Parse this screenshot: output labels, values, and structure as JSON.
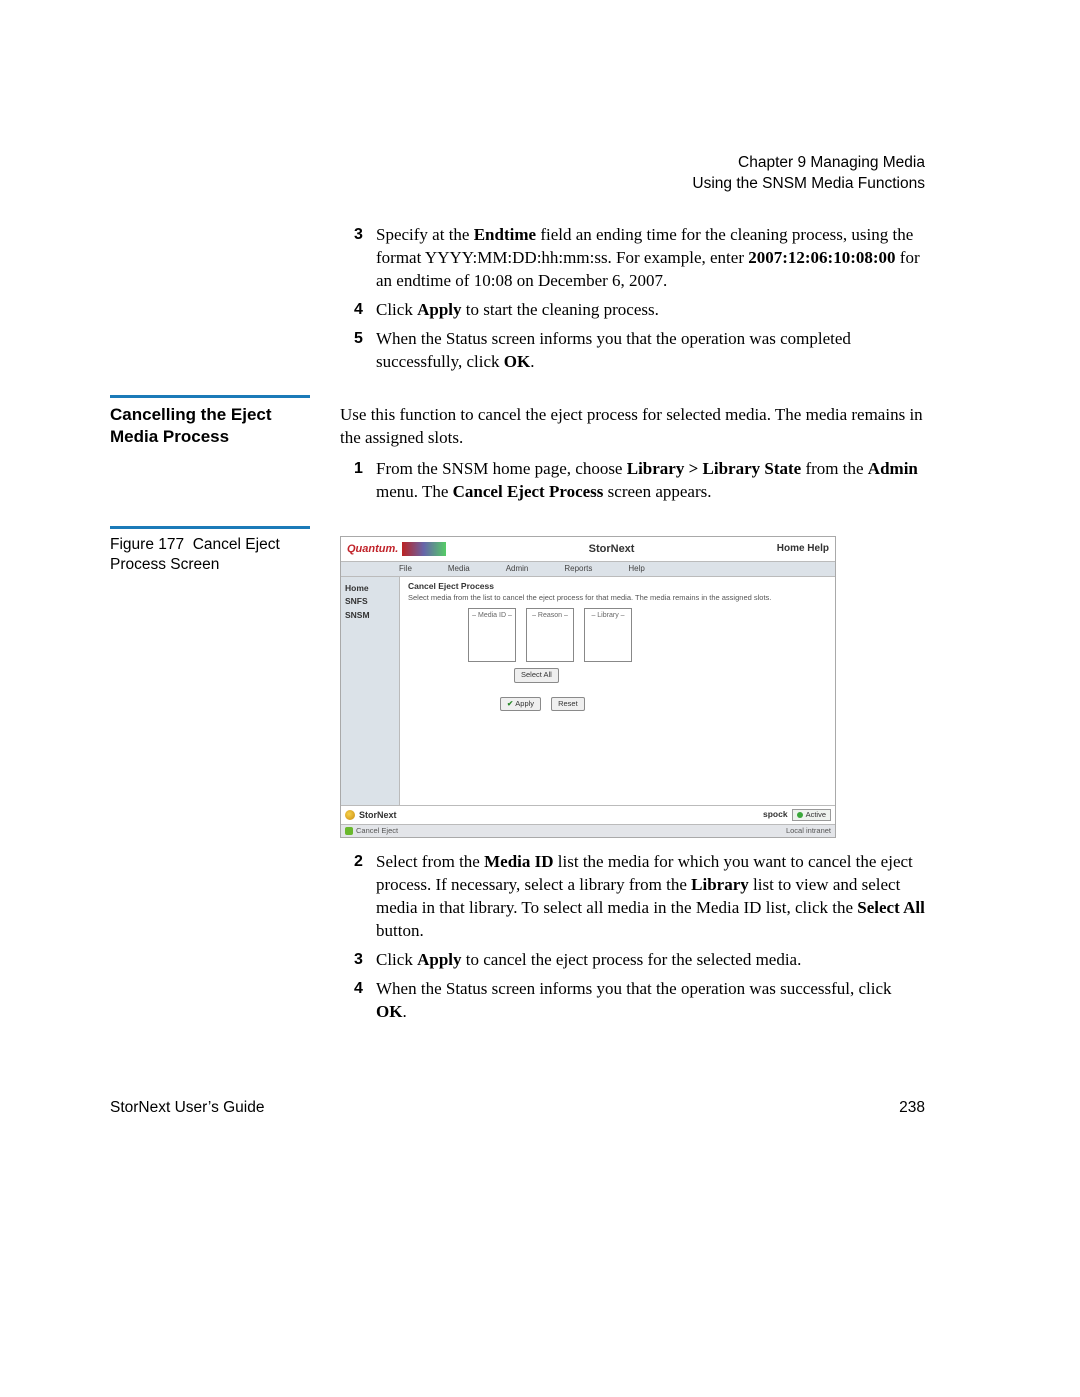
{
  "header": {
    "chapter": "Chapter 9  Managing Media",
    "subtitle": "Using the SNSM Media Functions"
  },
  "top_steps": {
    "s3": {
      "num": "3",
      "pre": "Specify at the ",
      "b1": "Endtime",
      "mid": " field an ending time for the cleaning process, using the format YYYY:MM:DD:hh:mm:ss. For example, enter ",
      "b2": "2007:12:06:10:08:00",
      "post": " for an endtime of 10:08 on December 6, 2007."
    },
    "s4": {
      "num": "4",
      "pre": "Click ",
      "b1": "Apply",
      "post": " to start the cleaning process."
    },
    "s5": {
      "num": "5",
      "pre": "When the Status screen informs you that the operation was completed successfully, click ",
      "b1": "OK",
      "post": "."
    }
  },
  "section": {
    "heading": "Cancelling the Eject Media Process",
    "intro": "Use this function to cancel the eject process for selected media. The media remains in the assigned slots.",
    "s1": {
      "num": "1",
      "pre": "From the SNSM home page, choose ",
      "b1": "Library > Library State",
      "mid": " from the ",
      "b2": "Admin",
      "mid2": " menu. The ",
      "b3": "Cancel Eject Process",
      "post": " screen appears."
    }
  },
  "figure": {
    "label": "Figure 177",
    "caption": "Cancel Eject Process Screen"
  },
  "screenshot": {
    "brand": "Quantum.",
    "app_title": "StorNext",
    "home_help": "Home  Help",
    "menus": {
      "file": "File",
      "media": "Media",
      "admin": "Admin",
      "reports": "Reports",
      "help": "Help"
    },
    "side": {
      "home": "Home",
      "snfs": "SNFS",
      "snsm": "SNSM"
    },
    "panel_title": "Cancel Eject Process",
    "panel_desc": "Select media from the list to cancel the eject process for that media. The media remains in the assigned slots.",
    "list_headers": {
      "media": "– Media ID –",
      "reason": "– Reason –",
      "library": "– Library –"
    },
    "buttons": {
      "select_all": "Select All",
      "apply": "Apply",
      "reset": "Reset"
    },
    "status_left": "StorNext",
    "status_host": "spock",
    "status_badge": "Active",
    "ie_left": "Cancel Eject",
    "ie_right": "Local intranet"
  },
  "after_steps": {
    "s2": {
      "num": "2",
      "pre": "Select from the ",
      "b1": "Media ID",
      "mid": " list the media for which you want to cancel the eject process. If necessary, select a library from the ",
      "b2": "Library",
      "mid2": " list to view and select media in that library. To select all media in the Media ID list, click the ",
      "b3": "Select All",
      "post": " button."
    },
    "s3": {
      "num": "3",
      "pre": "Click ",
      "b1": "Apply",
      "post": " to cancel the eject process for the selected media."
    },
    "s4": {
      "num": "4",
      "pre": "When the Status screen informs you that the operation was successful, click ",
      "b1": "OK",
      "post": "."
    }
  },
  "footer": {
    "left": "StorNext User’s Guide",
    "right": "238"
  }
}
